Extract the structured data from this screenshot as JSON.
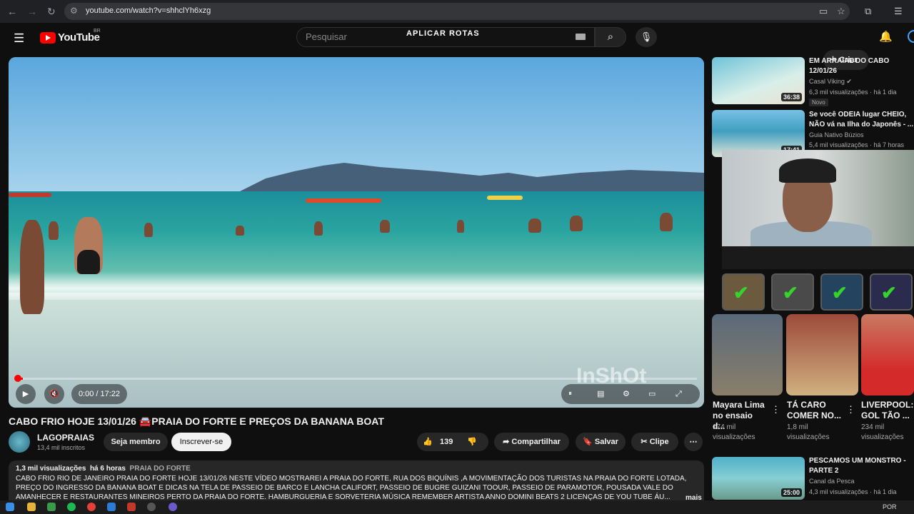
{
  "browser": {
    "url": "youtube.com/watch?v=shhclYh6xzg",
    "back_icon": "←",
    "forward_icon": "→",
    "reload_icon": "↻"
  },
  "header": {
    "logo_text": "YouTube",
    "country_code": "BR",
    "search_placeholder": "Pesquisar",
    "overlay_text": "APLICAR ROTAS",
    "create_label": "Criar"
  },
  "player": {
    "time": "0:00 / 17:22",
    "watermark": "InShOt",
    "progress_fraction": 0.01
  },
  "video": {
    "title": "CABO FRIO HOJE 13/01/26 🚘PRAIA DO FORTE E PREÇOS DA BANANA BOAT",
    "channel": "LAGOPRAIAS",
    "subscribers": "13,4 mil inscritos",
    "member_label": "Seja membro",
    "subscribe_label": "Inscrever-se",
    "likes": "139",
    "share_label": "Compartilhar",
    "save_label": "Salvar",
    "clip_label": "Clipe"
  },
  "description": {
    "views": "1,3 mil visualizações",
    "age": "há 6 horas",
    "tag": "PRAIA DO FORTE",
    "line1": "CABO FRIO RIO DE JANEIRO PRAIA DO FORTE HOJE 13/01/26 NESTE VÍDEO MOSTRAREI A PRAIA DO FORTE, RUA DOS BIQUÍNIS ,A MOVIMENTAÇÃO DOS TURISTAS NA PRAIA DO FORTE LOTADA,",
    "line2": "PREÇO DO INGRESSO DA BANANA BOAT E DICAS NA TELA DE PASSEIO DE BARCO E LANCHA CALIFORT,  PASSEIO DE BUGRE GUIZANI TOOUR,  PASSEIO DE PARAMOTOR, POUSADA VALE DO",
    "line3": "AMANHECER E RESTAURANTES MINEIROS PERTO DA PRAIA DO FORTE. HAMBURGUERIA E SORVETERIA  MÚSICA REMEMBER ARTISTA ANNO DOMINI BEATS 2 LICENÇAS DE YOU TUBE ÁU...",
    "more_label": "mais"
  },
  "related": [
    {
      "title": "EM ARRAIAL DO CABO 12/01/26",
      "channel": "Casal Viking",
      "views": "6,3 mil visualizações · há 1 dia",
      "duration": "36:38",
      "badge": "Novo"
    },
    {
      "title": "Se você ODEIA lugar CHEIO, NÃO vá na Ilha do Japonês - ...",
      "channel": "Guia Nativo Búzios",
      "views": "5,4 mil visualizações · há 7 horas",
      "duration": "17:41"
    },
    {
      "title": "PESCAMOS UM MONSTRO - PARTE 2",
      "channel": "Canal da Pesca",
      "views": "4,3 mil visualizações · há 1 dia",
      "duration": "25:00"
    }
  ],
  "shorts": [
    {
      "title": "Mayara Lima no ensaio d...",
      "views": "174 mil visualizações"
    },
    {
      "title": "TÁ CARO COMER NO...",
      "views": "1,8 mil visualizações"
    },
    {
      "title": "LIVERPOOL: GOL TÃO ...",
      "views": "234 mil visualizações"
    }
  ],
  "taskbar": {
    "language": "POR"
  },
  "colors": {
    "accent_red": "#ff0000",
    "check_green": "#35d32c",
    "background": "#0f0f0f"
  }
}
